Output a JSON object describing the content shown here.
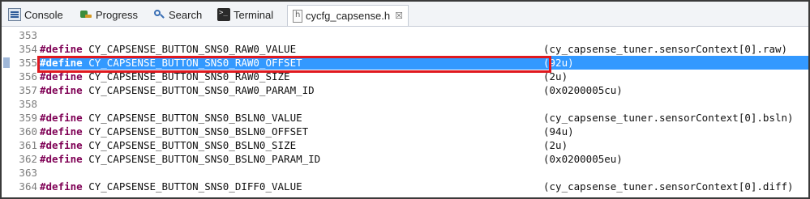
{
  "tabs": [
    {
      "label": "Console",
      "icon": "console-icon"
    },
    {
      "label": "Progress",
      "icon": "progress-icon"
    },
    {
      "label": "Search",
      "icon": "search-icon"
    },
    {
      "label": "Terminal",
      "icon": "terminal-icon"
    },
    {
      "label": "cycfg_capsense.h",
      "icon": "header-file-icon",
      "active": true,
      "close": "☒"
    }
  ],
  "editor": {
    "lines": [
      {
        "num": "353",
        "kw": "",
        "name": "",
        "value": ""
      },
      {
        "num": "354",
        "kw": "#define",
        "name": "CY_CAPSENSE_BUTTON_SNS0_RAW0_VALUE",
        "value": "(cy_capsense_tuner.sensorContext[0].raw)"
      },
      {
        "num": "355",
        "kw": "#define",
        "name": "CY_CAPSENSE_BUTTON_SNS0_RAW0_OFFSET",
        "value": "(92u)",
        "selected": true
      },
      {
        "num": "356",
        "kw": "#define",
        "name": "CY_CAPSENSE_BUTTON_SNS0_RAW0_SIZE",
        "value": "(2u)"
      },
      {
        "num": "357",
        "kw": "#define",
        "name": "CY_CAPSENSE_BUTTON_SNS0_RAW0_PARAM_ID",
        "value": "(0x0200005cu)"
      },
      {
        "num": "358",
        "kw": "",
        "name": "",
        "value": ""
      },
      {
        "num": "359",
        "kw": "#define",
        "name": "CY_CAPSENSE_BUTTON_SNS0_BSLN0_VALUE",
        "value": "(cy_capsense_tuner.sensorContext[0].bsln)"
      },
      {
        "num": "360",
        "kw": "#define",
        "name": "CY_CAPSENSE_BUTTON_SNS0_BSLN0_OFFSET",
        "value": "(94u)"
      },
      {
        "num": "361",
        "kw": "#define",
        "name": "CY_CAPSENSE_BUTTON_SNS0_BSLN0_SIZE",
        "value": "(2u)"
      },
      {
        "num": "362",
        "kw": "#define",
        "name": "CY_CAPSENSE_BUTTON_SNS0_BSLN0_PARAM_ID",
        "value": "(0x0200005eu)"
      },
      {
        "num": "363",
        "kw": "",
        "name": "",
        "value": ""
      },
      {
        "num": "364",
        "kw": "#define",
        "name": "CY_CAPSENSE_BUTTON_SNS0_DIFF0_VALUE",
        "value": "(cy_capsense_tuner.sensorContext[0].diff)"
      }
    ]
  },
  "colors": {
    "keyword": "#7f0055",
    "selection": "#3399ff",
    "annotation_box": "#e0191f"
  }
}
